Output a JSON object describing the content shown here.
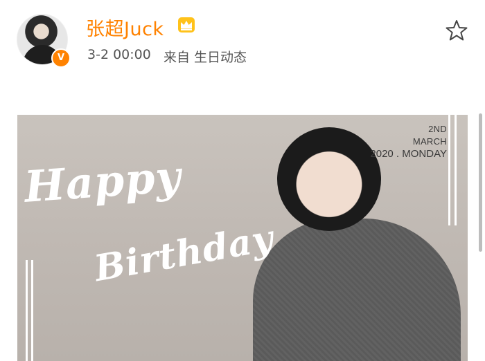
{
  "post": {
    "username": "张超Juck",
    "time": "3-2 00:00",
    "source": "来自 生日动态",
    "badge": "V"
  },
  "icons": {
    "crown": "crown-icon",
    "star": "star-icon",
    "verified": "verified-badge"
  },
  "image": {
    "date_day": "2ND",
    "date_month": "MARCH",
    "date_year": "2020 . MONDAY",
    "script_line1": "Happy",
    "script_line2": "Birthday"
  },
  "colors": {
    "brand_orange": "#ff8200",
    "meta_gray": "#555555",
    "image_bg": "#c4bdb7"
  }
}
